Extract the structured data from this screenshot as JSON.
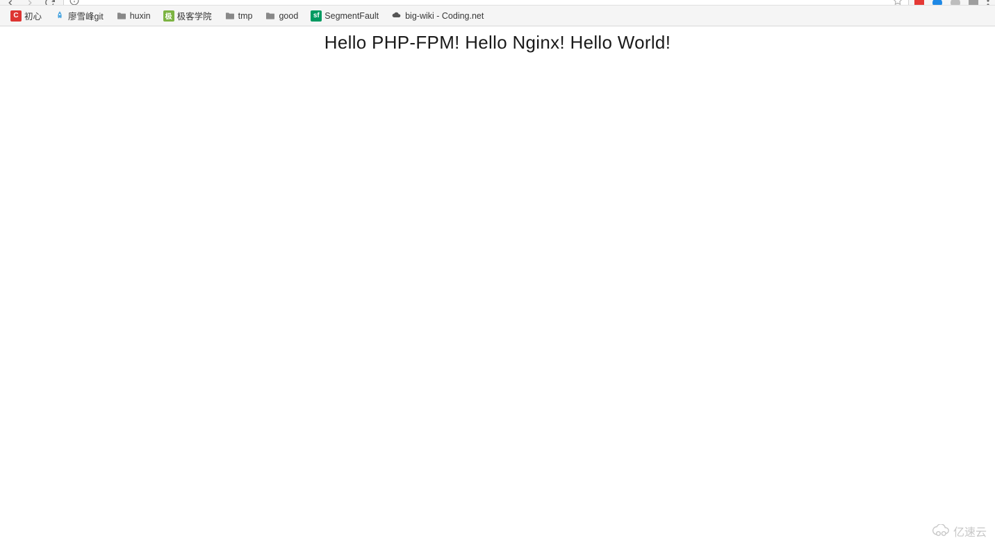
{
  "toolbar": {},
  "address_bar": {
    "value": ""
  },
  "bookmarks": [
    {
      "label": "初心",
      "icon_type": "box",
      "icon_bg": "#dd3532",
      "icon_text": "C"
    },
    {
      "label": "廖雪峰git",
      "icon_type": "rocket",
      "icon_bg": "",
      "icon_text": ""
    },
    {
      "label": "huxin",
      "icon_type": "folder",
      "icon_bg": "",
      "icon_text": ""
    },
    {
      "label": "极客学院",
      "icon_type": "box",
      "icon_bg": "#7cb342",
      "icon_text": "极"
    },
    {
      "label": "tmp",
      "icon_type": "folder",
      "icon_bg": "",
      "icon_text": ""
    },
    {
      "label": "good",
      "icon_type": "folder",
      "icon_bg": "",
      "icon_text": ""
    },
    {
      "label": "SegmentFault",
      "icon_type": "box",
      "icon_bg": "#009a61",
      "icon_text": "sf"
    },
    {
      "label": "big-wiki - Coding.net",
      "icon_type": "cloud",
      "icon_bg": "",
      "icon_text": ""
    }
  ],
  "page": {
    "heading": "Hello PHP-FPM! Hello Nginx! Hello World!"
  },
  "watermark": {
    "text": "亿速云"
  }
}
